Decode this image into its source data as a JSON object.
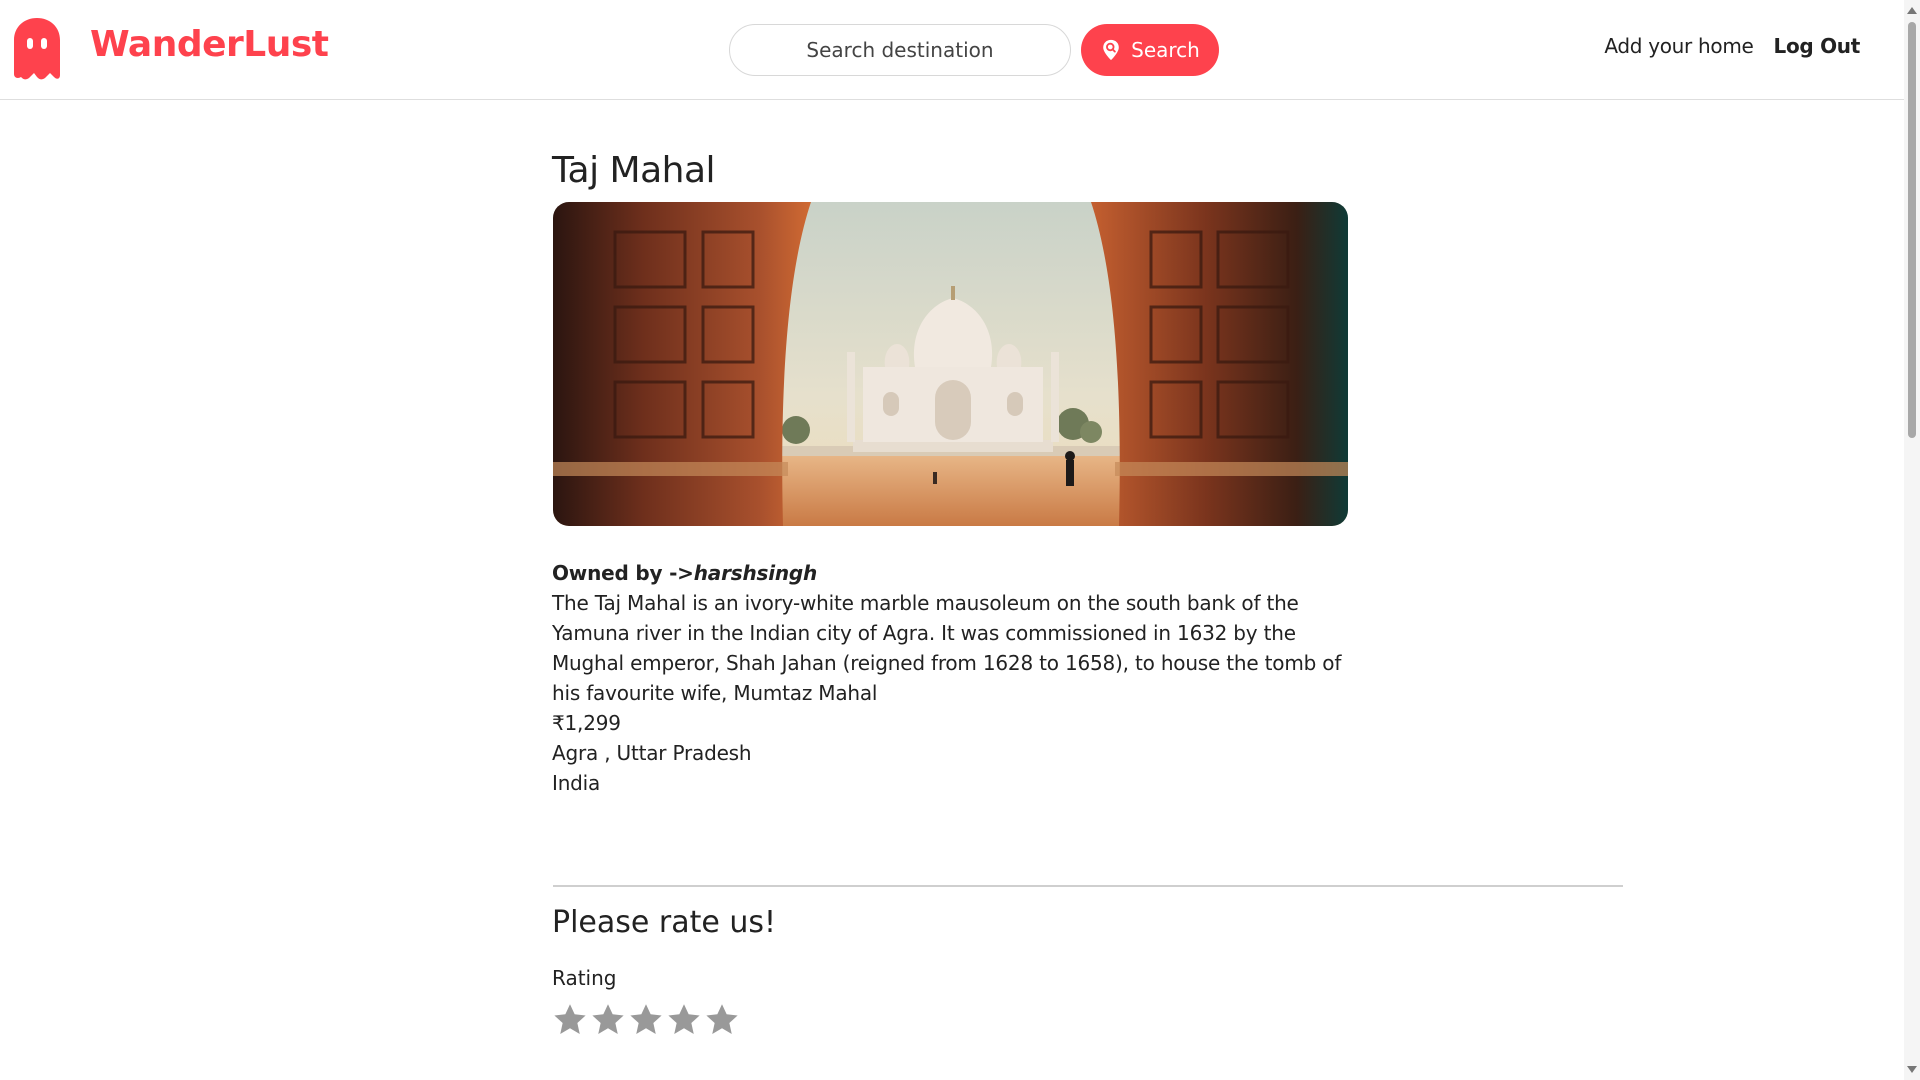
{
  "navbar": {
    "brand": "WanderLust",
    "search_placeholder": "Search destination",
    "search_button": "Search",
    "add_home": "Add your home",
    "logout": "Log Out"
  },
  "listing": {
    "title": "Taj Mahal",
    "image_alt": "Taj Mahal viewed through carved red sandstone doorway",
    "owner_label": "Owned by ->",
    "owner": "harshsingh",
    "description": "The Taj Mahal is an ivory-white marble mausoleum on the south bank of the Yamuna river in the Indian city of Agra. It was commissioned in 1632 by the Mughal emperor, Shah Jahan (reigned from 1628 to 1658), to house the tomb of his favourite wife, Mumtaz Mahal",
    "price": "₹1,299",
    "location": "Agra , Uttar Pradesh",
    "country": "India"
  },
  "review": {
    "heading": "Please rate us!",
    "rating_label": "Rating",
    "stars_max": 5,
    "stars_selected": 0
  },
  "colors": {
    "accent": "#fe424d",
    "star_inactive": "#999999"
  }
}
